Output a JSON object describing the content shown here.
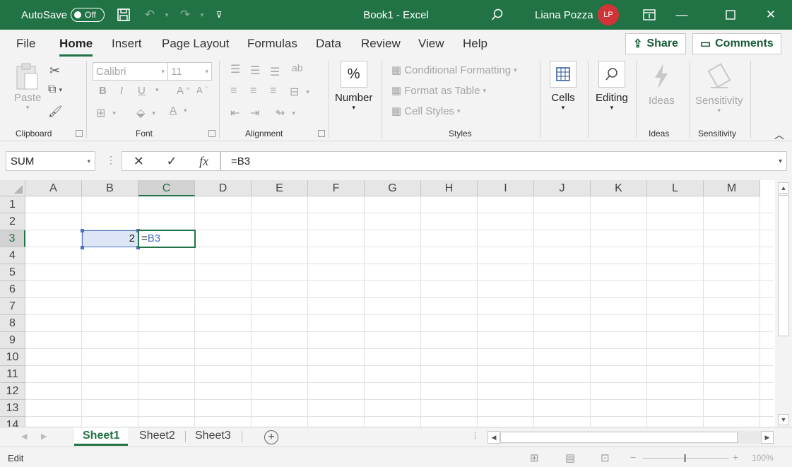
{
  "title_bar": {
    "autosave_label": "AutoSave",
    "autosave_state": "Off",
    "document_title": "Book1  -  Excel",
    "user_name": "Liana Pozza",
    "user_initials": "LP"
  },
  "ribbon_tabs": [
    "File",
    "Home",
    "Insert",
    "Page Layout",
    "Formulas",
    "Data",
    "Review",
    "View",
    "Help"
  ],
  "ribbon_actions": {
    "share": "Share",
    "comments": "Comments"
  },
  "clipboard": {
    "paste": "Paste",
    "group": "Clipboard"
  },
  "font": {
    "name": "Calibri",
    "size": "11",
    "bold": "B",
    "italic": "I",
    "underline": "U",
    "grow": "A",
    "shrink": "A",
    "font_color": "A",
    "group": "Font"
  },
  "alignment": {
    "group": "Alignment"
  },
  "number": {
    "label": "Number",
    "icon": "%"
  },
  "styles": {
    "conditional": "Conditional Formatting",
    "table": "Format as Table",
    "cell_styles": "Cell Styles",
    "group": "Styles"
  },
  "cells": {
    "label": "Cells"
  },
  "editing": {
    "label": "Editing"
  },
  "ideas": {
    "label": "Ideas",
    "group": "Ideas"
  },
  "sensitivity": {
    "label": "Sensitivity",
    "group": "Sensitivity"
  },
  "formula_bar": {
    "name_box": "SUM",
    "formula": "=B3",
    "fx": "fx"
  },
  "columns": [
    "A",
    "B",
    "C",
    "D",
    "E",
    "F",
    "G",
    "H",
    "I",
    "J",
    "K",
    "L",
    "M"
  ],
  "rows": [
    "1",
    "2",
    "3",
    "4",
    "5",
    "6",
    "7",
    "8",
    "9",
    "10",
    "11",
    "12",
    "13",
    "14"
  ],
  "cells_content": {
    "B3": "2",
    "C3_prefix": "=",
    "C3_ref": "B3"
  },
  "sheets": [
    "Sheet1",
    "Sheet2",
    "Sheet3"
  ],
  "status": {
    "mode": "Edit",
    "zoom": "100%"
  },
  "colors": {
    "brand": "#217346",
    "reference": "#4472c4",
    "avatar": "#d13438"
  }
}
